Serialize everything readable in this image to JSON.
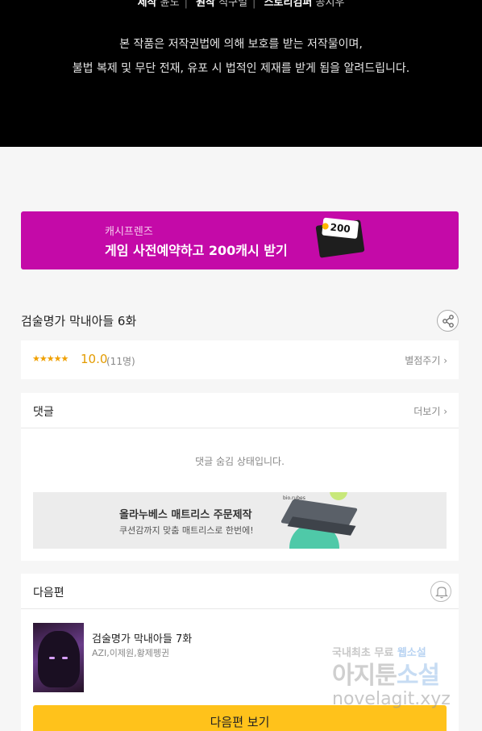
{
  "credits": {
    "parts": [
      {
        "role": "제작",
        "name": "윤도"
      },
      {
        "role": "원작",
        "name": "직구멀"
      },
      {
        "role": "스토리컴퍼",
        "name": "공지우"
      }
    ]
  },
  "notice": {
    "line1": "본 작품은 저작권법에 의해 보호를 받는 저작물이며,",
    "line2": "불법 복제 및 무단 전재, 유포 시 법적인 제재를 받게 됨을 알려드립니다."
  },
  "banner": {
    "sub": "캐시프렌즈",
    "main": "게임 사전예약하고 200캐시 받기",
    "envelope_text": "200",
    "color": "#c40aa8"
  },
  "episode": {
    "title": "검술명가 막내아들 6화",
    "share_icon": "share-icon"
  },
  "rating": {
    "stars": "★★★★★",
    "score": "10.0",
    "count": "(11명)",
    "rate_button": "별점주기 ›"
  },
  "comments": {
    "title": "댓글",
    "more": "더보기 ›",
    "hidden_message": "댓글 숨김 상태입니다."
  },
  "ad": {
    "brand": "bio.rubes",
    "title": "올라누베스 매트리스 주문제작",
    "sub": "쿠션감까지 맞춤 매트리스로 한번에!"
  },
  "next": {
    "heading": "다음편",
    "bell_icon": "bell-icon",
    "title": "검술명가 막내아들 7화",
    "authors": "AZI,이제원,황제펭귄",
    "button": "다음편 보기",
    "button_color": "#ffc21b"
  },
  "watermark": {
    "line1_a": "국내최초 무료",
    "line1_b": "웹소설",
    "line2_a": "아지툰",
    "line2_b": "소설",
    "line3": "novelagit.xyz"
  }
}
